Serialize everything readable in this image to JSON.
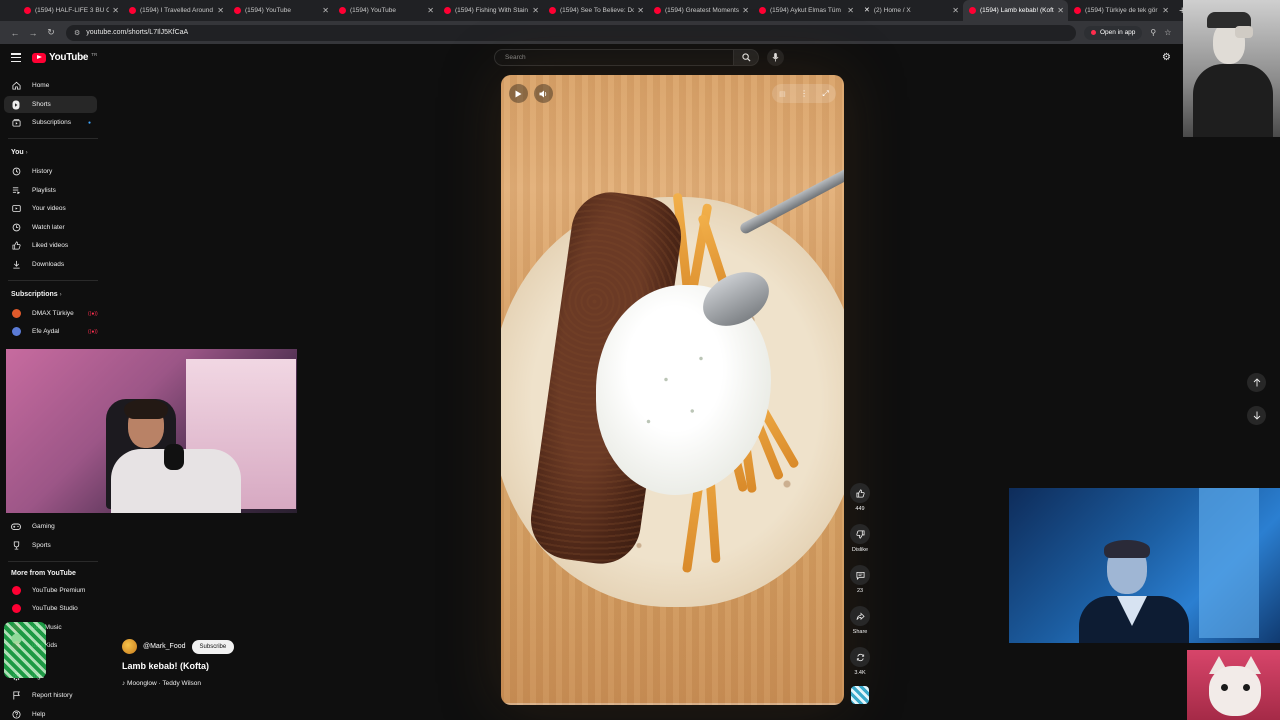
{
  "browser": {
    "tabs": [
      {
        "title": "(1594) HALF-LIFE 3 BU Cl",
        "favicon": "youtube",
        "active": false
      },
      {
        "title": "(1594) I Travelled Around",
        "favicon": "youtube",
        "active": false
      },
      {
        "title": "(1594) YouTube",
        "favicon": "youtube",
        "active": false
      },
      {
        "title": "(1594) YouTube",
        "favicon": "youtube",
        "active": false
      },
      {
        "title": "(1594) Fishing With Stain",
        "favicon": "youtube",
        "active": false
      },
      {
        "title": "(1594) See To Believe: Do",
        "favicon": "youtube",
        "active": false
      },
      {
        "title": "(1594) Greatest Moments",
        "favicon": "youtube",
        "active": false
      },
      {
        "title": "(1594) Aykut Elmas Tüm",
        "favicon": "youtube",
        "active": false
      },
      {
        "title": "(2) Home / X",
        "favicon": "x",
        "active": false
      },
      {
        "title": "(1594) Lamb kebab! (Kofta",
        "favicon": "youtube",
        "active": true
      },
      {
        "title": "(1594) Türkiye de tek gör",
        "favicon": "youtube",
        "active": false
      }
    ],
    "url": "youtube.com/shorts/L7IlJ5KfCaA",
    "open_in_app": "Open in app"
  },
  "header": {
    "logo_text": "YouTube",
    "country_code": "TR",
    "search_placeholder": "Search"
  },
  "sidebar": {
    "main": [
      {
        "label": "Home",
        "icon": "home-icon"
      },
      {
        "label": "Shorts",
        "icon": "shorts-icon",
        "active": true
      },
      {
        "label": "Subscriptions",
        "icon": "subscriptions-icon"
      }
    ],
    "you_heading": "You",
    "you_items": [
      {
        "label": "History",
        "icon": "history-icon"
      },
      {
        "label": "Playlists",
        "icon": "playlists-icon"
      },
      {
        "label": "Your videos",
        "icon": "your-videos-icon"
      },
      {
        "label": "Watch later",
        "icon": "watch-later-icon"
      },
      {
        "label": "Liked videos",
        "icon": "like-icon"
      },
      {
        "label": "Downloads",
        "icon": "download-icon"
      }
    ],
    "subs_heading": "Subscriptions",
    "subs": [
      {
        "label": "DMAX Türkiye",
        "color": "#e05a2b"
      },
      {
        "label": "Efe Aydal",
        "color": "#5b7bd6"
      }
    ],
    "explore": [
      {
        "label": "Gaming",
        "icon": "gaming-icon"
      },
      {
        "label": "Sports",
        "icon": "trophy-icon"
      }
    ],
    "more_heading": "More from YouTube",
    "more": [
      {
        "label": "YouTube Premium",
        "color": "#ff0033"
      },
      {
        "label": "YouTube Studio",
        "color": "#ff0033"
      },
      {
        "label": "ube Music",
        "color": "#ff0033"
      },
      {
        "label": "ube Kids",
        "color": "#ff0033"
      }
    ],
    "bottom": [
      {
        "label": "ings",
        "icon": "settings-icon"
      },
      {
        "label": "Report history",
        "icon": "flag-icon"
      },
      {
        "label": "Help",
        "icon": "help-icon"
      }
    ]
  },
  "short": {
    "channel": "@Mark_Food",
    "subscribe_label": "Subscribe",
    "title": "Lamb kebab! (Kofta)",
    "music": "♪ Moonglow · Teddy Wilson",
    "likes": "449",
    "dislike_label": "Dislike",
    "comments": "23",
    "share_label": "Share",
    "remix_count": "3.4K",
    "progress_fraction": 0.0
  }
}
